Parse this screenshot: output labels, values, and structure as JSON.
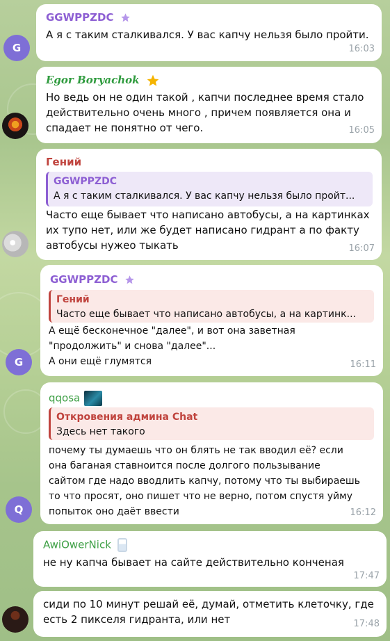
{
  "messages": [
    {
      "author": "GGWPPZDC",
      "text": "А я с таким сталкивался. У вас капчу нельзя было пройти.",
      "time": "16:03",
      "avatar_letter": "G"
    },
    {
      "author": "Egor Boryachok",
      "text": "Но ведь он не один такой , капчи последнее время стало\nдействительно очень много , причем появляется она и\nспадает не понятно от чего.",
      "time": "16:05"
    },
    {
      "author": "Гений",
      "reply_author": "GGWPPZDC",
      "reply_text": "А я с таким сталкивался. У вас капчу нельзя было пройт...",
      "text": "Часто еще бывает что написано автобусы, а на картинках\nих тупо нет, или же будет написано гидрант а по факту\nавтобусы нужео тыкать",
      "time": "16:07"
    },
    {
      "author": "GGWPPZDC",
      "reply_author": "Гений",
      "reply_text": "Часто еще бывает что написано автобусы, а на картинк...",
      "text": "А ещё бесконечное \"далее\", и вот она заветная\n\"продолжить\" и снова \"далее\"...\n А они ещё глумятся",
      "time": "16:11",
      "avatar_letter": "G"
    },
    {
      "author": "qqosa",
      "reply_author": "Откровения админа Chat",
      "reply_text": "Здесь нет такого",
      "text": "почему ты думаешь что он блять не так вводил её? если\nона баганая ставноится  после долгого пользывание\nсайтом где надо вводлить капчу, потому что ты выбираешь\nто что просят, оно пишет что не верно, потом спустя уйму\nпопыток оно даёт ввести",
      "time": "16:12",
      "avatar_letter": "Q"
    },
    {
      "author": "AwiOwerNick",
      "text": "не ну капча бывает на сайте действительно конченая",
      "time": "17:47"
    },
    {
      "text": "сиди по 10 минут решай её, думай, отметить клеточку, где\nесть 2 пикселя гидранта, или нет",
      "time": "17:48"
    }
  ],
  "colors": {
    "ggwppzdc": "#8d5fd3",
    "egor": "#2f9b3e",
    "genius": "#c0443e",
    "qqosa": "#3fa046",
    "awiower": "#3fa046",
    "reply_purple_bg": "#eee8f8",
    "reply_red_bg": "#fbe9e7"
  },
  "icons": [
    "premium-star-icon",
    "gold-star-icon",
    "qqosa-emoji-icon",
    "milk-emoji-icon"
  ]
}
